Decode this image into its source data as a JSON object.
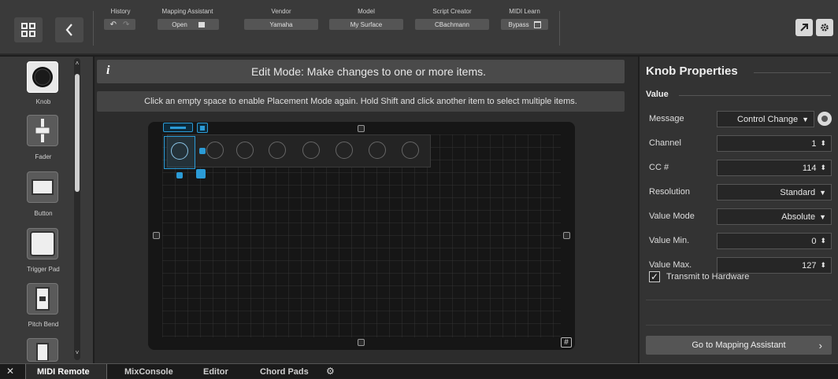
{
  "toolbar": {
    "history_label": "History",
    "mapping_assistant_label": "Mapping Assistant",
    "mapping_assistant_value": "Open",
    "vendor_label": "Vendor",
    "vendor_value": "Yamaha",
    "model_label": "Model",
    "model_value": "My Surface",
    "script_creator_label": "Script Creator",
    "script_creator_value": "CBachmann",
    "midi_learn_label": "MIDI Learn",
    "midi_learn_value": "Bypass"
  },
  "palette": {
    "items": [
      {
        "label": "Knob"
      },
      {
        "label": "Fader"
      },
      {
        "label": "Button"
      },
      {
        "label": "Trigger Pad"
      },
      {
        "label": "Pitch Bend"
      }
    ]
  },
  "center": {
    "info_text": "Edit Mode: Make changes to one or more items.",
    "hint_text": "Click an empty space to enable Placement Mode again. Hold Shift and click another item to select multiple items."
  },
  "properties": {
    "title": "Knob Properties",
    "section": "Value",
    "rows": [
      {
        "label": "Message",
        "value": "Control Change"
      },
      {
        "label": "Channel",
        "value": "1"
      },
      {
        "label": "CC #",
        "value": "114"
      },
      {
        "label": "Resolution",
        "value": "Standard"
      },
      {
        "label": "Value Mode",
        "value": "Absolute"
      },
      {
        "label": "Value Min.",
        "value": "0"
      },
      {
        "label": "Value Max.",
        "value": "127"
      }
    ],
    "transmit_label": "Transmit to Hardware",
    "transmit_checked": true,
    "goto_label": "Go to Mapping Assistant"
  },
  "tabs": {
    "items": [
      "MIDI Remote",
      "MixConsole",
      "Editor",
      "Chord Pads"
    ],
    "active": "MIDI Remote"
  },
  "colors": {
    "accent": "#2b9bd6",
    "background": "#2c2c2c",
    "panel": "#3a3a3a"
  }
}
